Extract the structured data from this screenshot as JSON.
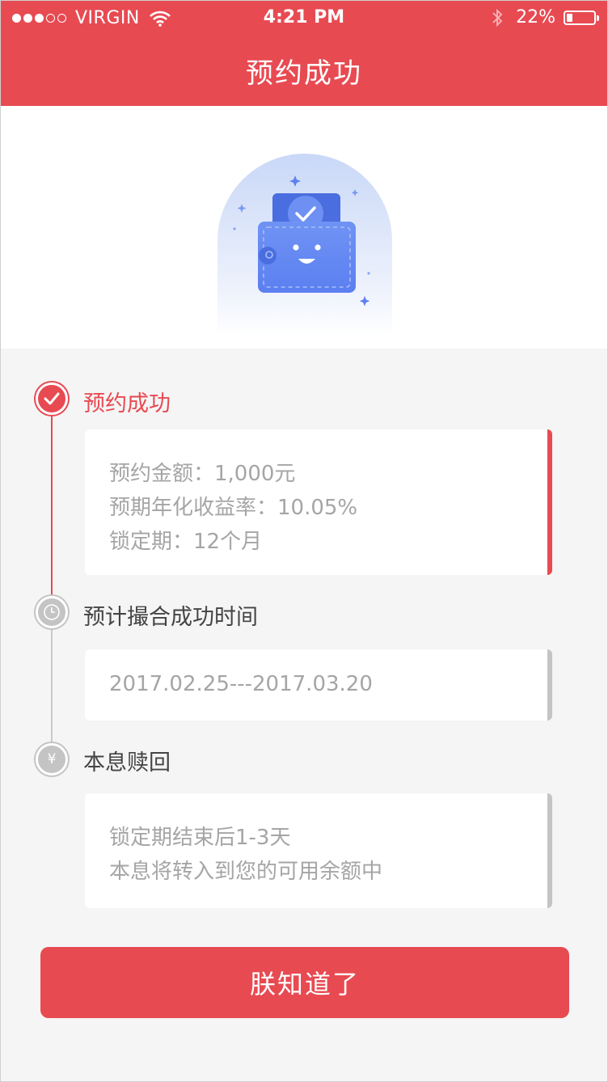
{
  "status_bar": {
    "carrier": "VIRGIN",
    "time": "4:21 PM",
    "battery_text": "22%",
    "signal_filled": 3,
    "signal_total": 5
  },
  "nav": {
    "title": "预约成功"
  },
  "colors": {
    "accent": "#e84a52",
    "inactive": "#c4c4c4",
    "text_muted": "#a5a5a5"
  },
  "steps": [
    {
      "title": "预约成功",
      "icon": "check-icon",
      "lines": [
        "预约金额：1,000元",
        "预期年化收益率：10.05%",
        "锁定期：12个月"
      ]
    },
    {
      "title": "预计撮合成功时间",
      "icon": "clock-icon",
      "lines": [
        "2017.02.25---2017.03.20"
      ]
    },
    {
      "title": "本息赎回",
      "icon": "yen-icon",
      "lines": [
        "锁定期结束后1-3天",
        "本息将转入到您的可用余额中"
      ]
    }
  ],
  "button": {
    "label": "朕知道了"
  }
}
